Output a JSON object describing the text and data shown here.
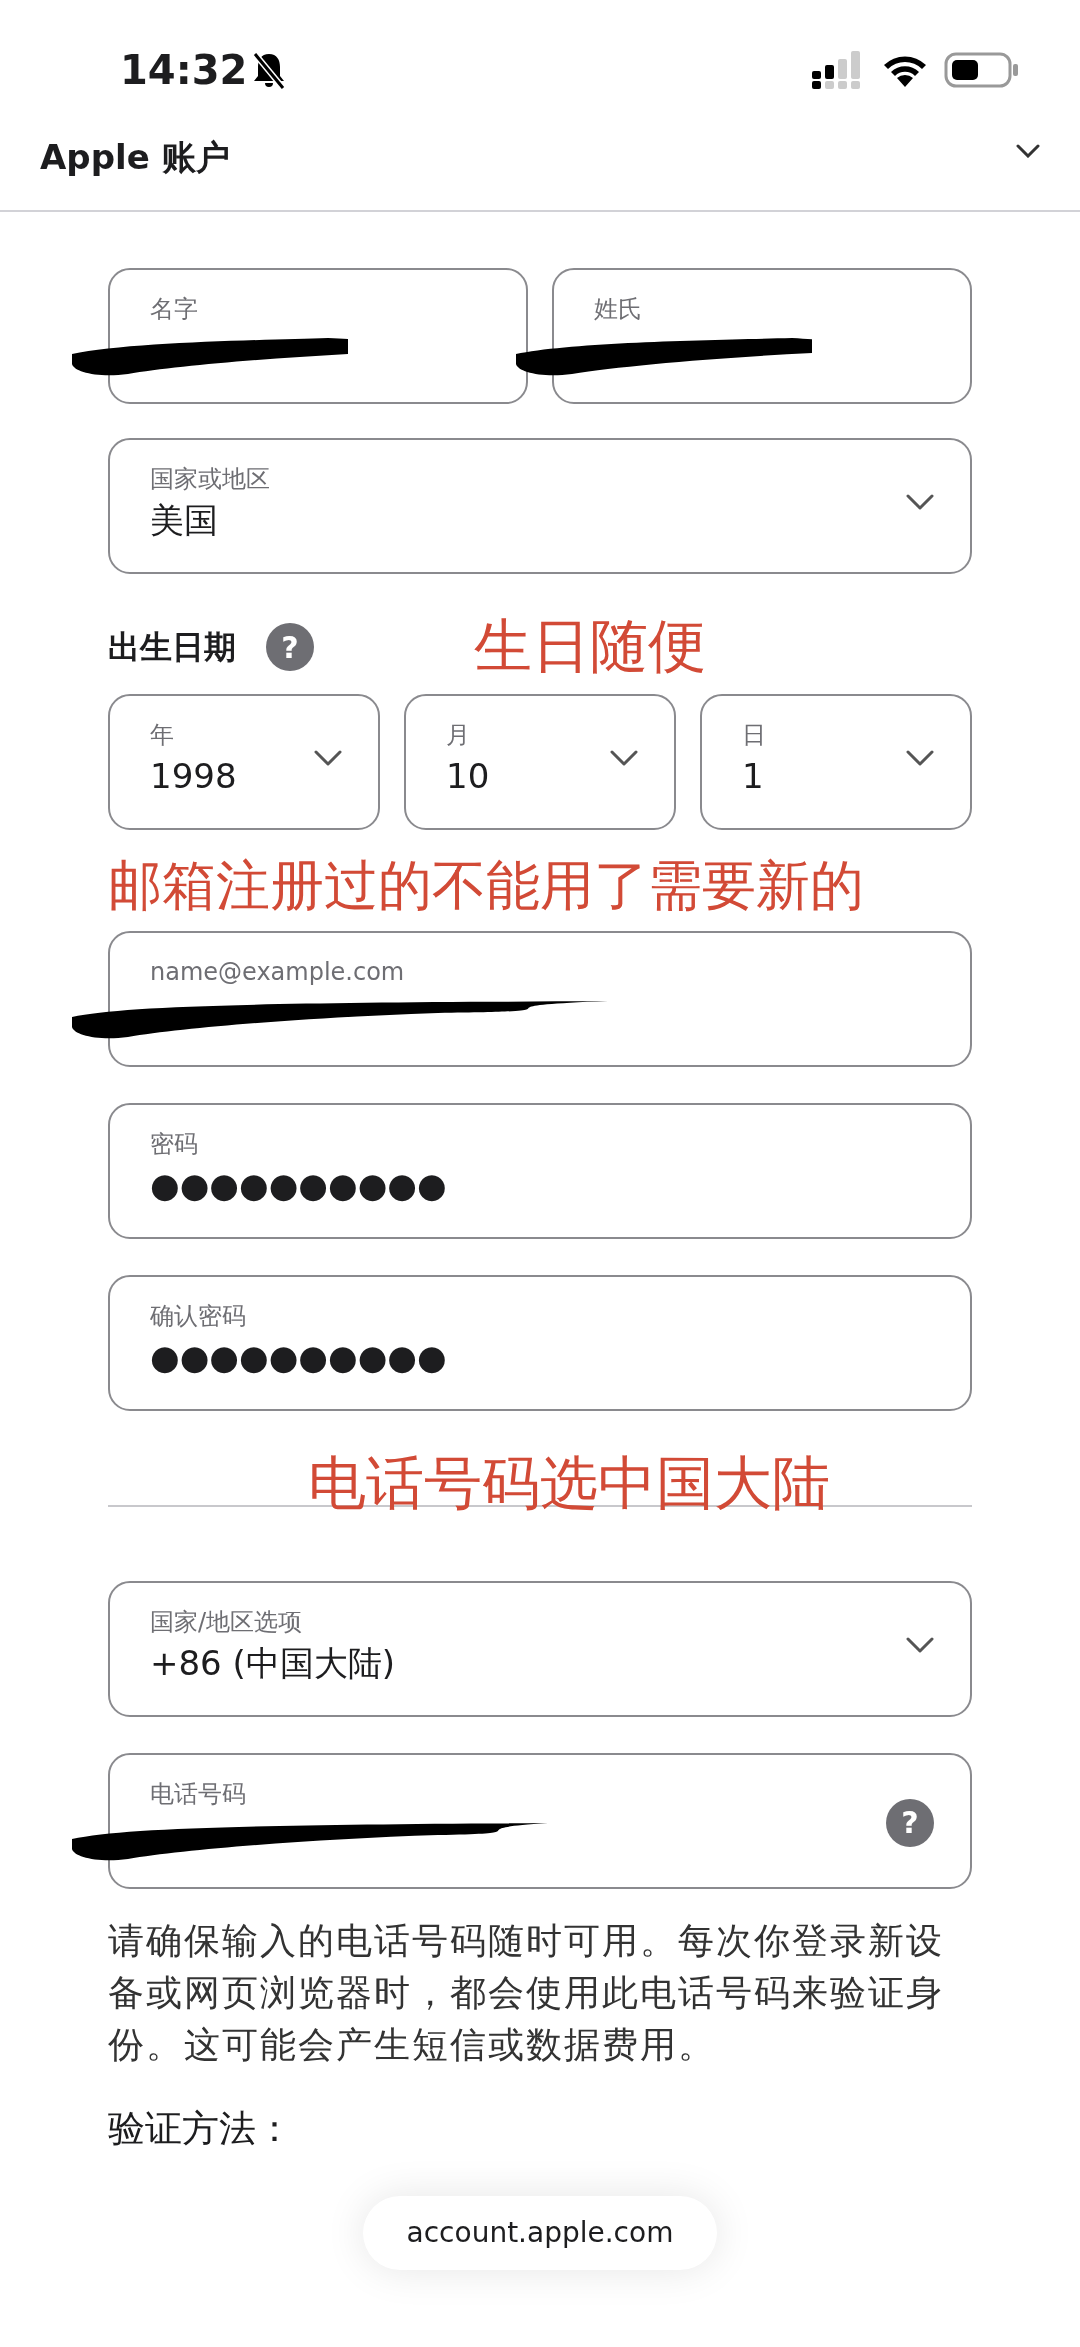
{
  "status_bar": {
    "time": "14:32",
    "silent": true
  },
  "header": {
    "title": "Apple 账户"
  },
  "name_fields": [
    {
      "label": "名字",
      "redacted": true
    },
    {
      "label": "姓氏",
      "redacted": true
    }
  ],
  "country": {
    "label": "国家或地区",
    "value": "美国"
  },
  "birthday": {
    "title": "出生日期",
    "help": "?",
    "fields": [
      {
        "label": "年",
        "value": "1998"
      },
      {
        "label": "月",
        "value": "10"
      },
      {
        "label": "日",
        "value": "1"
      }
    ]
  },
  "email": {
    "placeholder": "name@example.com",
    "redacted": true
  },
  "password": {
    "label": "密码",
    "value": "●●●●●●●●●●"
  },
  "confirm_password": {
    "label": "确认密码",
    "value": "●●●●●●●●●●"
  },
  "phone_country": {
    "label": "国家/地区选项",
    "value": "+86 (中国大陆)"
  },
  "phone": {
    "label": "电话号码",
    "redacted": true,
    "help": "?"
  },
  "notice": "请确保输入的电话号码随时可用。每次你登录新设备或网页浏览器时，都会使用此电话号码来验证身份。这可能会产生短信或数据费用。",
  "verification_title": "验证方法：",
  "url_bar": {
    "url": "account.apple.com"
  },
  "annotations": [
    {
      "text": "生日随便"
    },
    {
      "text": "邮箱注册过的不能用了需要新的"
    },
    {
      "text": "电话号码选中国大陆"
    }
  ]
}
